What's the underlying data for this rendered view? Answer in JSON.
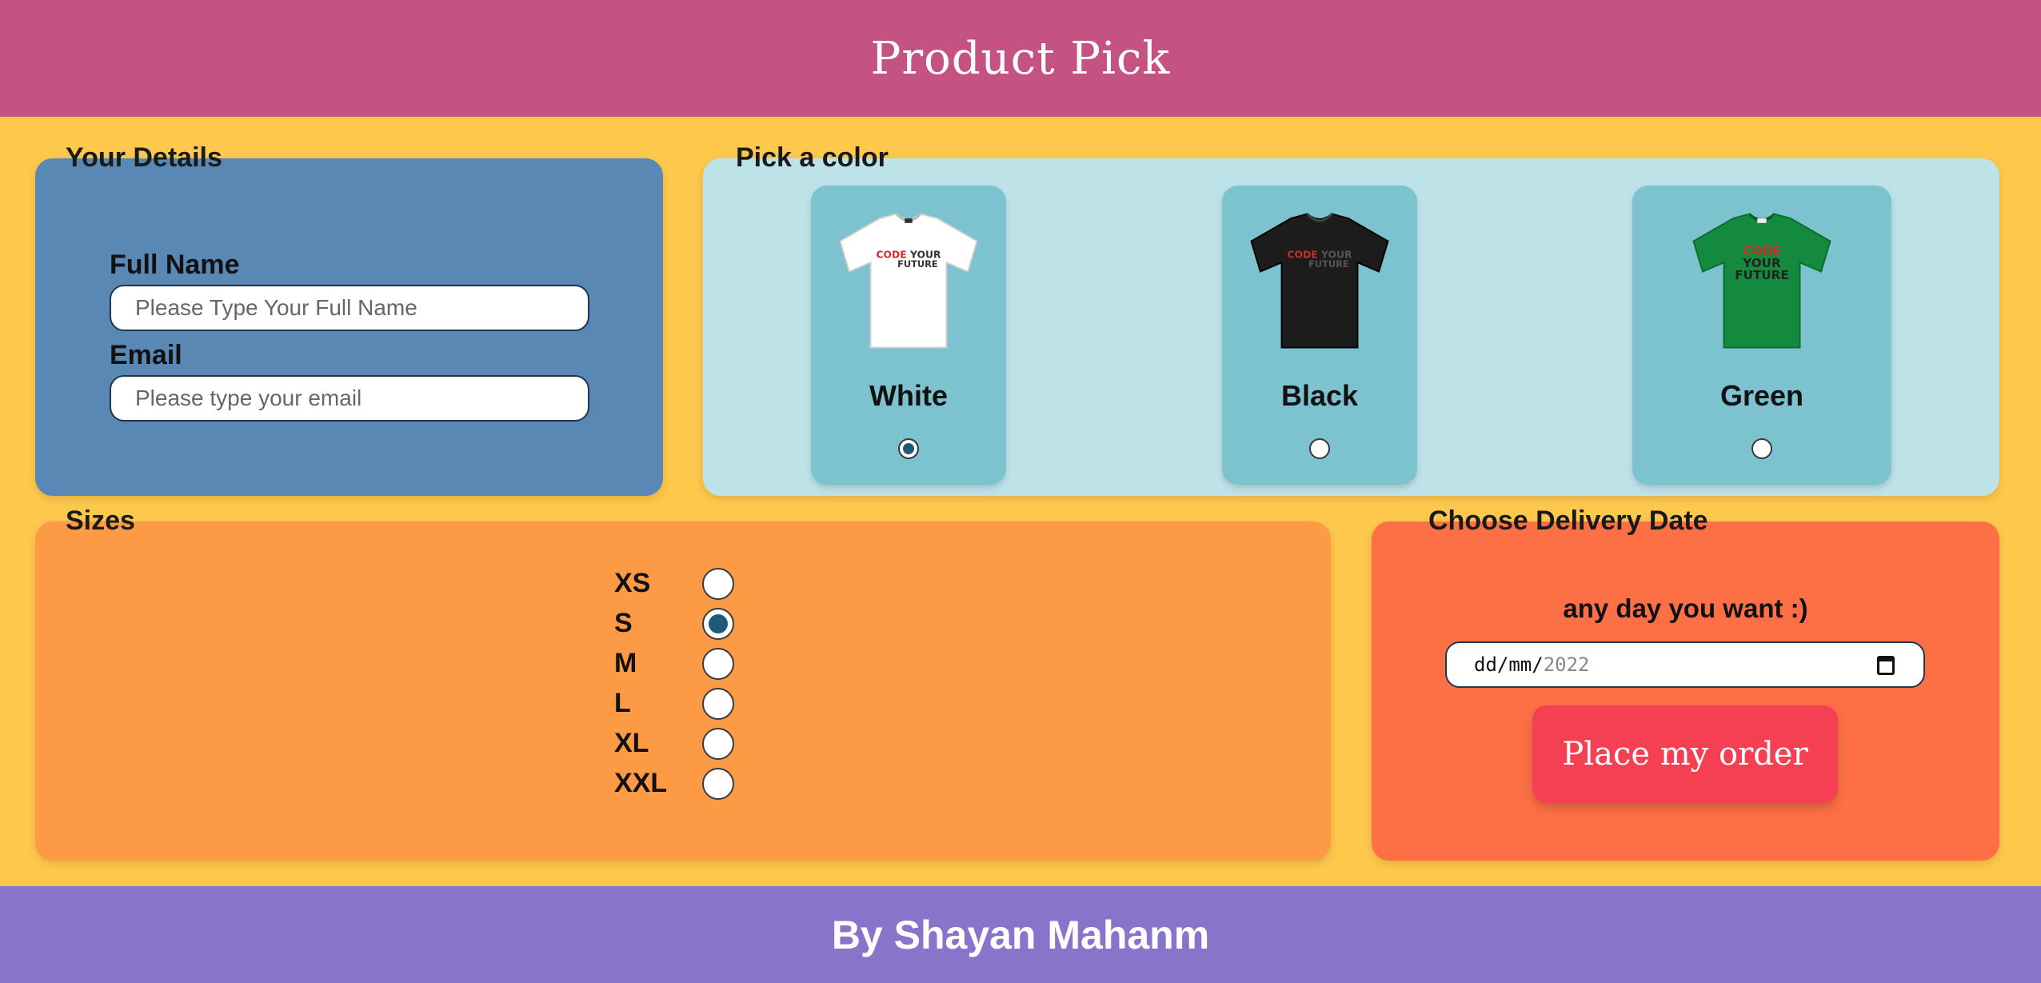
{
  "header": {
    "title": "Product Pick"
  },
  "details": {
    "title": "Your Details",
    "full_name_label": "Full Name",
    "full_name_placeholder": "Please Type Your Full Name",
    "email_label": "Email",
    "email_placeholder": "Please type your email"
  },
  "colors": {
    "title": "Pick a color",
    "options": [
      {
        "name": "White",
        "selected": true,
        "shirt_color": "#ffffff",
        "logo": [
          "CODE",
          "YOUR",
          "FUTURE"
        ]
      },
      {
        "name": "Black",
        "selected": false,
        "shirt_color": "#1c1c1c",
        "logo": [
          "CODE",
          "YOUR",
          "FUTURE"
        ]
      },
      {
        "name": "Green",
        "selected": false,
        "shirt_color": "#138a3e",
        "logo": [
          "CODE",
          "YOUR",
          "FUTURE"
        ]
      }
    ]
  },
  "sizes": {
    "title": "Sizes",
    "options": [
      {
        "label": "XS",
        "selected": false
      },
      {
        "label": "S",
        "selected": true
      },
      {
        "label": "M",
        "selected": false
      },
      {
        "label": "L",
        "selected": false
      },
      {
        "label": "XL",
        "selected": false
      },
      {
        "label": "XXL",
        "selected": false
      }
    ]
  },
  "delivery": {
    "title": "Choose Delivery Date",
    "hint": "any day you want :)",
    "date_day_month": "dd/mm/",
    "date_year": "2022",
    "date_icon": "calendar-icon",
    "order_button": "Place my order"
  },
  "footer": {
    "text": "By Shayan Mahanm"
  },
  "theme": {
    "background": "#fec84d",
    "header": "#c45283",
    "details_panel": "#5888b3",
    "color_panel": "#bde3e8",
    "sizes_panel": "#fd9a46",
    "delivery_panel": "#fd7046",
    "order_button": "#f53f52",
    "footer": "#8875cb"
  }
}
